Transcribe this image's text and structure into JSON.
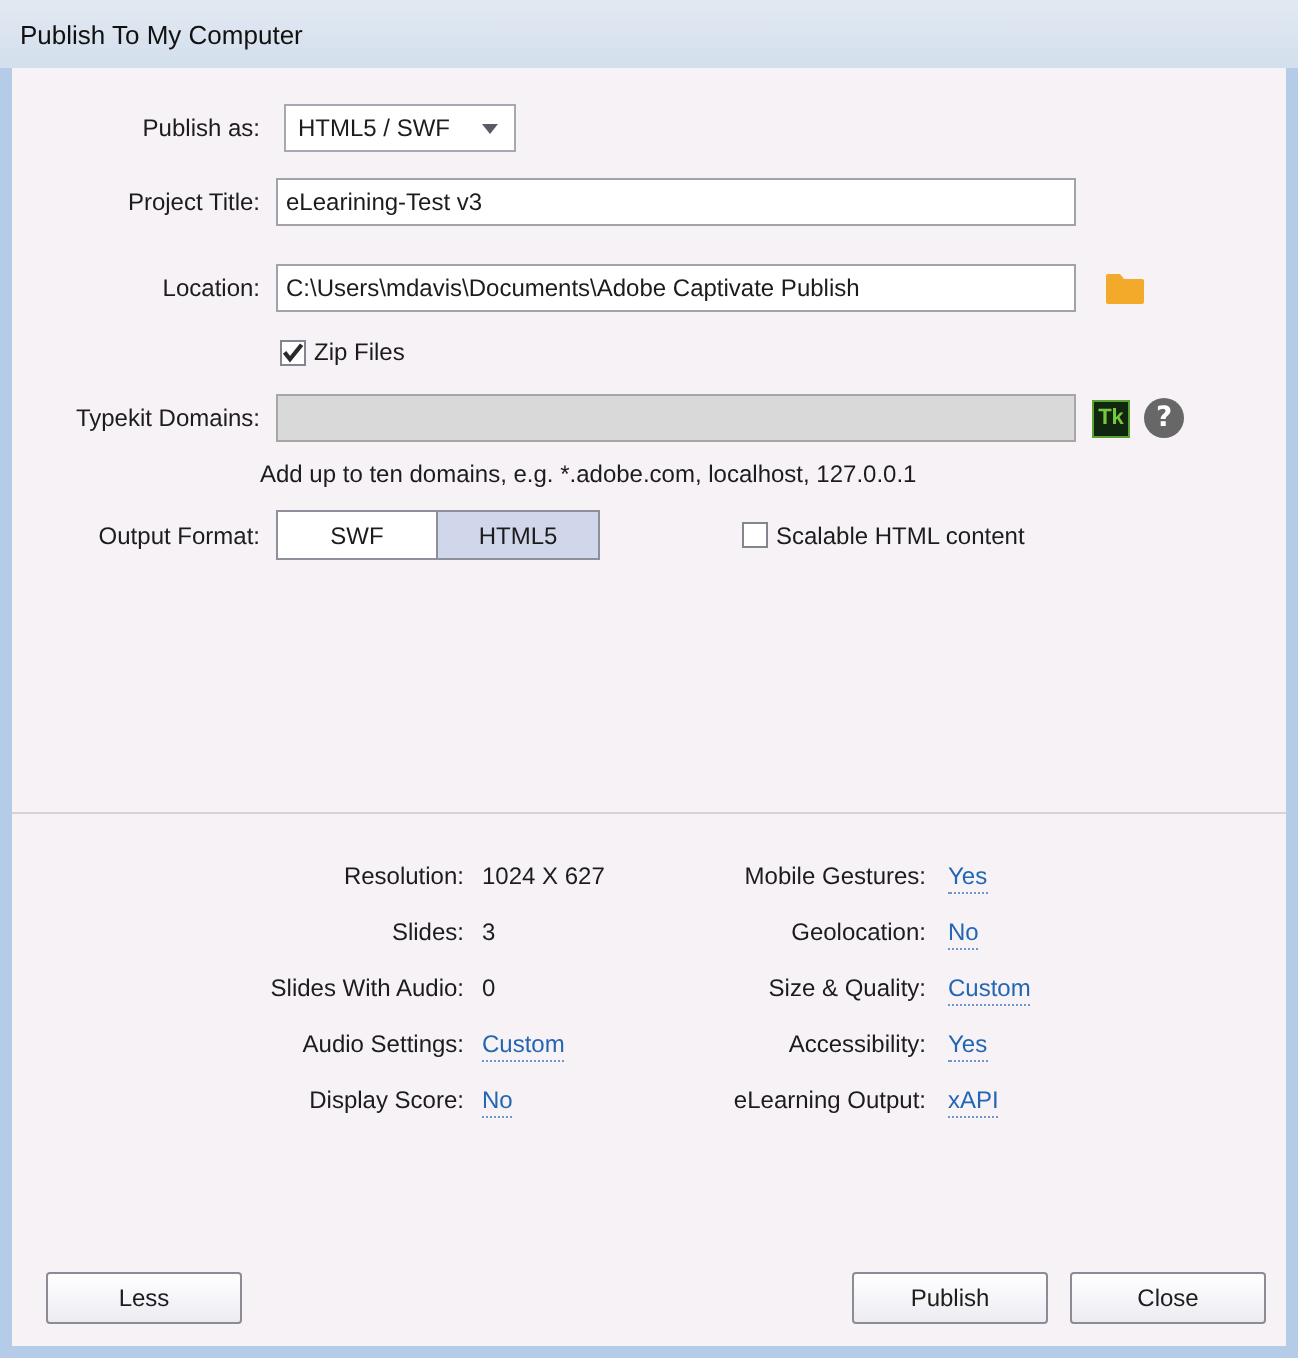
{
  "window": {
    "title": "Publish To My Computer"
  },
  "form": {
    "publish_as": {
      "label": "Publish as:",
      "value": "HTML5 / SWF"
    },
    "project_title": {
      "label": "Project Title:",
      "value": "eLearining-Test v3"
    },
    "location": {
      "label": "Location:",
      "value": "C:\\Users\\mdavis\\Documents\\Adobe Captivate Publish"
    },
    "zip_files": {
      "label": "Zip Files",
      "checked": true
    },
    "typekit_domains": {
      "label": "Typekit Domains:",
      "disabled": true,
      "logo": "Tk",
      "help": "?",
      "hint": "Add up to ten domains, e.g. *.adobe.com, localhost, 127.0.0.1"
    },
    "output_format": {
      "label": "Output Format:",
      "options": [
        {
          "label": "SWF",
          "selected": false
        },
        {
          "label": "HTML5",
          "selected": true
        }
      ]
    },
    "scalable_html": {
      "label": "Scalable HTML content",
      "checked": false
    }
  },
  "summary": {
    "left": [
      {
        "label": "Resolution:",
        "value": "1024 X 627",
        "kind": "text"
      },
      {
        "label": "Slides:",
        "value": "3",
        "kind": "text"
      },
      {
        "label": "Slides With Audio:",
        "value": "0",
        "kind": "text"
      },
      {
        "label": "Audio Settings:",
        "value": "Custom",
        "kind": "link"
      },
      {
        "label": "Display Score:",
        "value": "No",
        "kind": "link"
      }
    ],
    "right": [
      {
        "label": "Mobile Gestures:",
        "value": "Yes",
        "kind": "link"
      },
      {
        "label": "Geolocation:",
        "value": "No",
        "kind": "link"
      },
      {
        "label": "Size & Quality:",
        "value": "Custom",
        "kind": "link"
      },
      {
        "label": "Accessibility:",
        "value": "Yes",
        "kind": "link"
      },
      {
        "label": "eLearning Output:",
        "value": "xAPI",
        "kind": "link"
      }
    ]
  },
  "footer": {
    "left_buttons": [
      "Less"
    ],
    "right_buttons": [
      "Publish",
      "Close"
    ]
  }
}
